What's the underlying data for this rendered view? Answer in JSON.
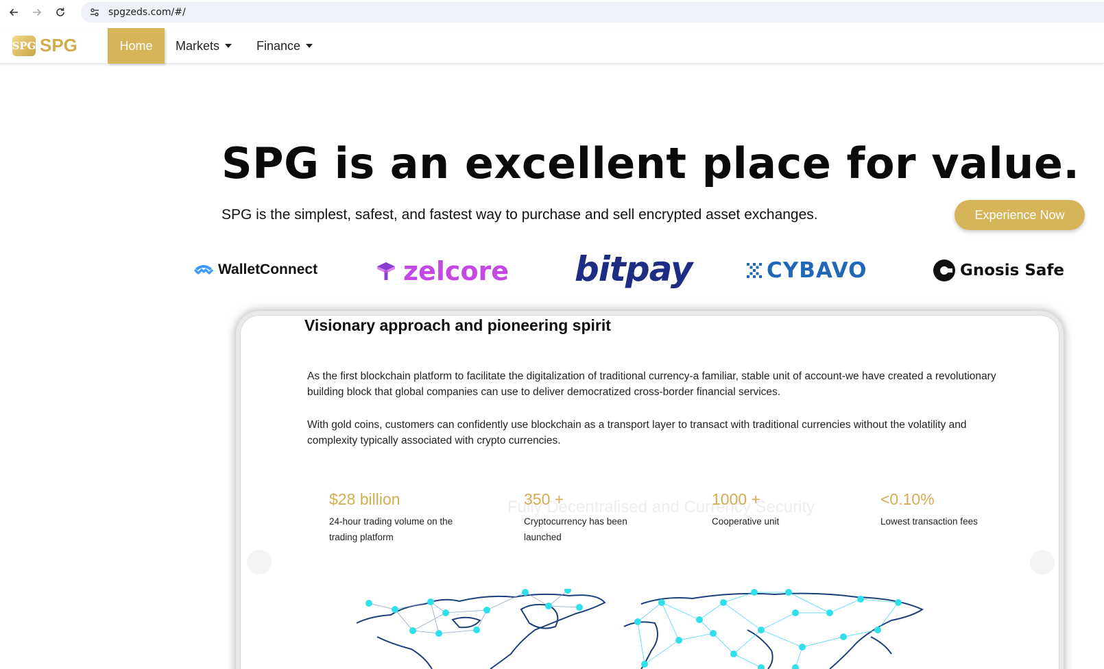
{
  "browser": {
    "url": "spgzeds.com/#/"
  },
  "header": {
    "logo_mark": "SPG",
    "logo_text": "SPG",
    "nav": {
      "home": "Home",
      "markets": "Markets",
      "finance": "Finance"
    }
  },
  "hero": {
    "title": "SPG is an excellent place for value.",
    "subtitle": "SPG is the simplest, safest, and fastest way to purchase and sell encrypted asset exchanges.",
    "cta": "Experience Now"
  },
  "partners": {
    "walletconnect": "WalletConnect",
    "zelcore": "zelcore",
    "bitpay": "bitpay",
    "cybavo": "CYBAVO",
    "gnosis": "Gnosis Safe"
  },
  "card": {
    "title": "Visionary approach and pioneering spirit",
    "paragraph1": "As the first blockchain platform to facilitate the digitalization of traditional currency-a familiar, stable unit of account-we have created a revolutionary building block that global companies can use to deliver democratized cross-border financial services.",
    "paragraph2": "With gold coins, customers can confidently use blockchain as a transport layer to transact with traditional currencies without the volatility and complexity typically associated with crypto currencies.",
    "ghost_text": "Fully Decentralised and Currency Security",
    "stats": [
      {
        "value": "$28 billion",
        "label": "24-hour trading volume on the trading platform"
      },
      {
        "value": "350 +",
        "label": "Cryptocurrency has been launched"
      },
      {
        "value": "1000 +",
        "label": "Cooperative unit"
      },
      {
        "value": "<0.10%",
        "label": "Lowest transaction fees"
      }
    ]
  },
  "colors": {
    "accent_gold": "#d6b45a",
    "map_dots": "#2fe0ea",
    "map_outline": "#1c3f7a"
  }
}
